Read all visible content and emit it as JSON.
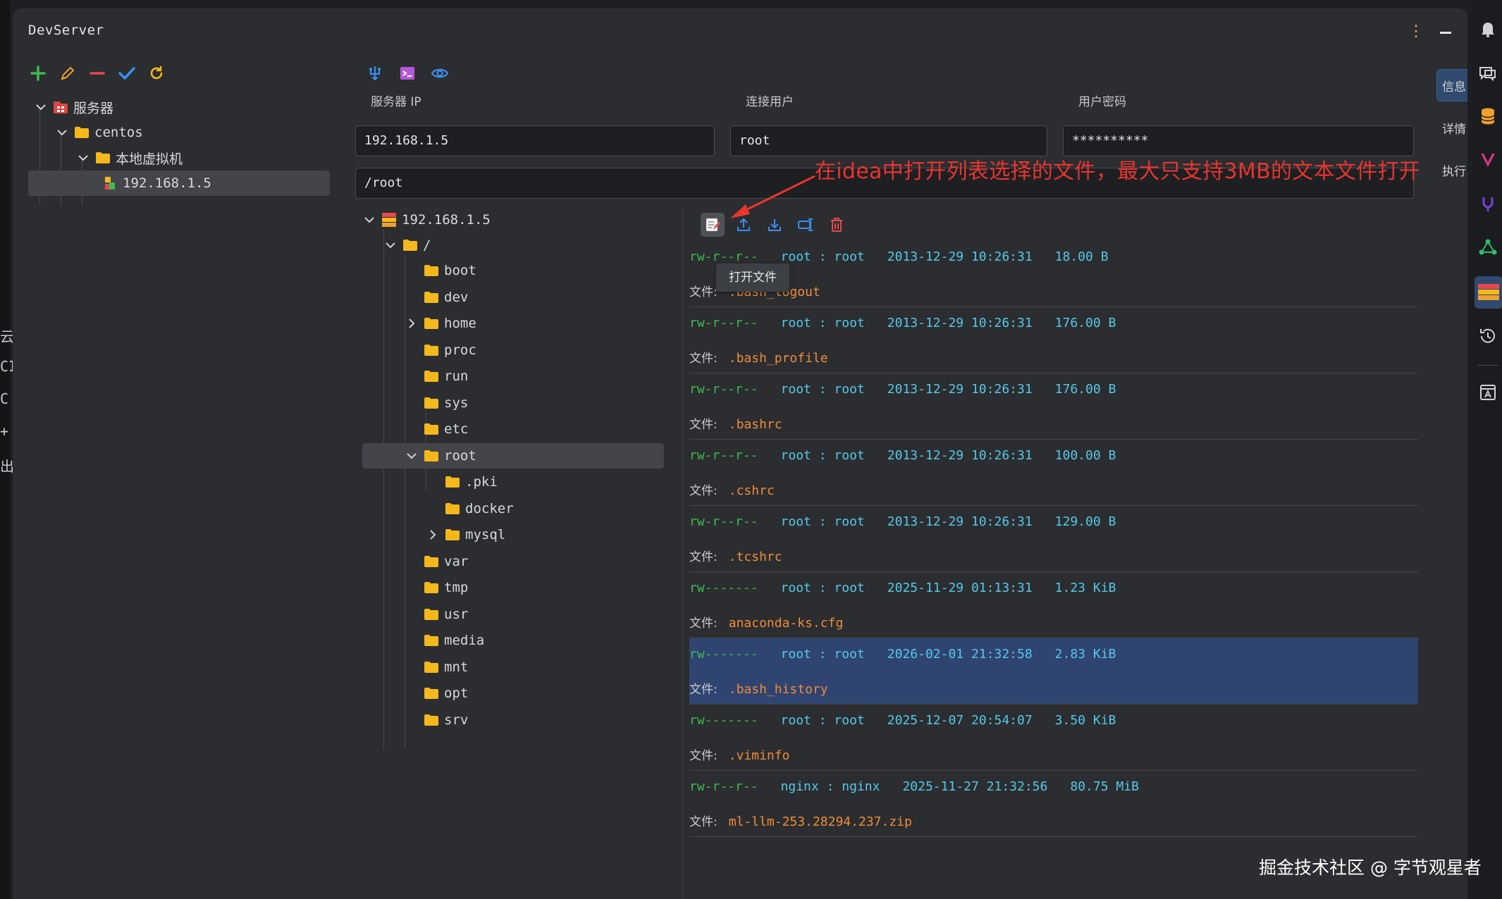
{
  "app": {
    "title": "DevServer"
  },
  "left_gutter_chars": [
    "云",
    "CI",
    "C",
    "+",
    "出"
  ],
  "server_tree": {
    "root_label": "服务器",
    "group_label": "centos",
    "subgroup_label": "本地虚拟机",
    "host_label": "192.168.1.5"
  },
  "form": {
    "ip_label": "服务器 IP",
    "user_label": "连接用户",
    "password_label": "用户密码",
    "ip_value": "192.168.1.5",
    "user_value": "root",
    "password_value": "**********",
    "path_value": "/root"
  },
  "right_tabs": [
    "信息",
    "详情",
    "执行"
  ],
  "annotation": "在idea中打开列表选择的文件，最大只支持3MB的文本文件打开",
  "remote_tree": {
    "host": "192.168.1.5",
    "root_dir": "/",
    "dirs": [
      "boot",
      "dev",
      "home",
      "proc",
      "run",
      "sys",
      "etc",
      "root",
      "var",
      "tmp",
      "usr",
      "media",
      "mnt",
      "opt",
      "srv"
    ],
    "root_children": [
      ".pki",
      "docker",
      "mysql"
    ]
  },
  "tooltip": "打开文件",
  "file_label": "文件:",
  "files": [
    {
      "perm": "rw-r--r--",
      "owner": "root : root",
      "time": "2013-12-29 10:26:31",
      "size": "18.00 B",
      "name": ".bash_logout"
    },
    {
      "perm": "rw-r--r--",
      "owner": "root : root",
      "time": "2013-12-29 10:26:31",
      "size": "176.00 B",
      "name": ".bash_profile"
    },
    {
      "perm": "rw-r--r--",
      "owner": "root : root",
      "time": "2013-12-29 10:26:31",
      "size": "176.00 B",
      "name": ".bashrc"
    },
    {
      "perm": "rw-r--r--",
      "owner": "root : root",
      "time": "2013-12-29 10:26:31",
      "size": "100.00 B",
      "name": ".cshrc"
    },
    {
      "perm": "rw-r--r--",
      "owner": "root : root",
      "time": "2013-12-29 10:26:31",
      "size": "129.00 B",
      "name": ".tcshrc"
    },
    {
      "perm": "rw-------",
      "owner": "root : root",
      "time": "2025-11-29 01:13:31",
      "size": "1.23 KiB",
      "name": "anaconda-ks.cfg"
    },
    {
      "perm": "rw-------",
      "owner": "root : root",
      "time": "2026-02-01 21:32:58",
      "size": "2.83 KiB",
      "name": ".bash_history"
    },
    {
      "perm": "rw-------",
      "owner": "root : root",
      "time": "2025-12-07 20:54:07",
      "size": "3.50 KiB",
      "name": ".viminfo"
    },
    {
      "perm": "rw-r--r--",
      "owner": "nginx : nginx",
      "time": "2025-11-27 21:32:56",
      "size": "80.75 MiB",
      "name": "ml-llm-253.28294.237.zip"
    }
  ],
  "selected_file_index": 6,
  "watermark": "掘金技术社区 @ 字节观星者",
  "colors": {
    "accent_green": "#3fb950",
    "accent_red": "#e8352f",
    "accent_cyan": "#56c8e8",
    "filename_orange": "#f28c3a",
    "folder_yellow": "#f5b81c",
    "selection_blue": "#2f4470"
  }
}
